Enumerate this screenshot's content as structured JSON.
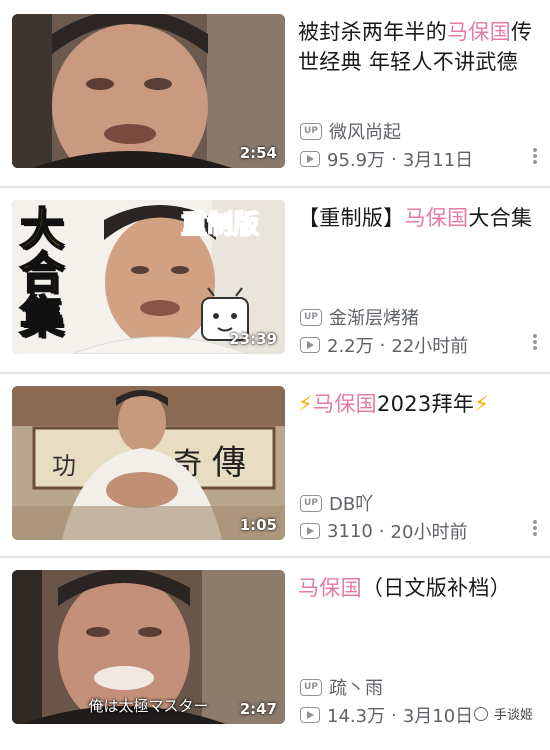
{
  "videos": [
    {
      "title_pre": "被封杀两年半的",
      "title_hl": "马保国",
      "title_post": "传世经典 年轻人不讲武德",
      "duration": "2:54",
      "uploader": "微风尚起",
      "views": "95.9万",
      "date": "3月11日"
    },
    {
      "title_pre": "【重制版】",
      "title_hl": "马保国",
      "title_post": "大合集",
      "duration": "23:39",
      "uploader": "金渐层烤猪",
      "views": "2.2万",
      "date": "22小时前",
      "thumb_text_left": "大合集",
      "thumb_text_right": "重制版"
    },
    {
      "title_pre": "",
      "title_hl": "马保国",
      "title_post": "2023拜年",
      "duration": "1:05",
      "uploader": "DB吖",
      "views": "3110",
      "date": "20小时前"
    },
    {
      "title_pre": "",
      "title_hl": "马保国",
      "title_post": "（日文版补档）",
      "duration": "2:47",
      "uploader": "疏丶雨",
      "views": "14.3万",
      "date": "3月10日",
      "thumb_subtitle": "俺は太極マスター"
    }
  ],
  "icons": {
    "up_label": "UP",
    "bolt": "⚡"
  },
  "watermark": "手谈姬",
  "colors": {
    "highlight": "#e47ba6",
    "meta": "#5f6368",
    "divider": "#e3e5e7"
  }
}
